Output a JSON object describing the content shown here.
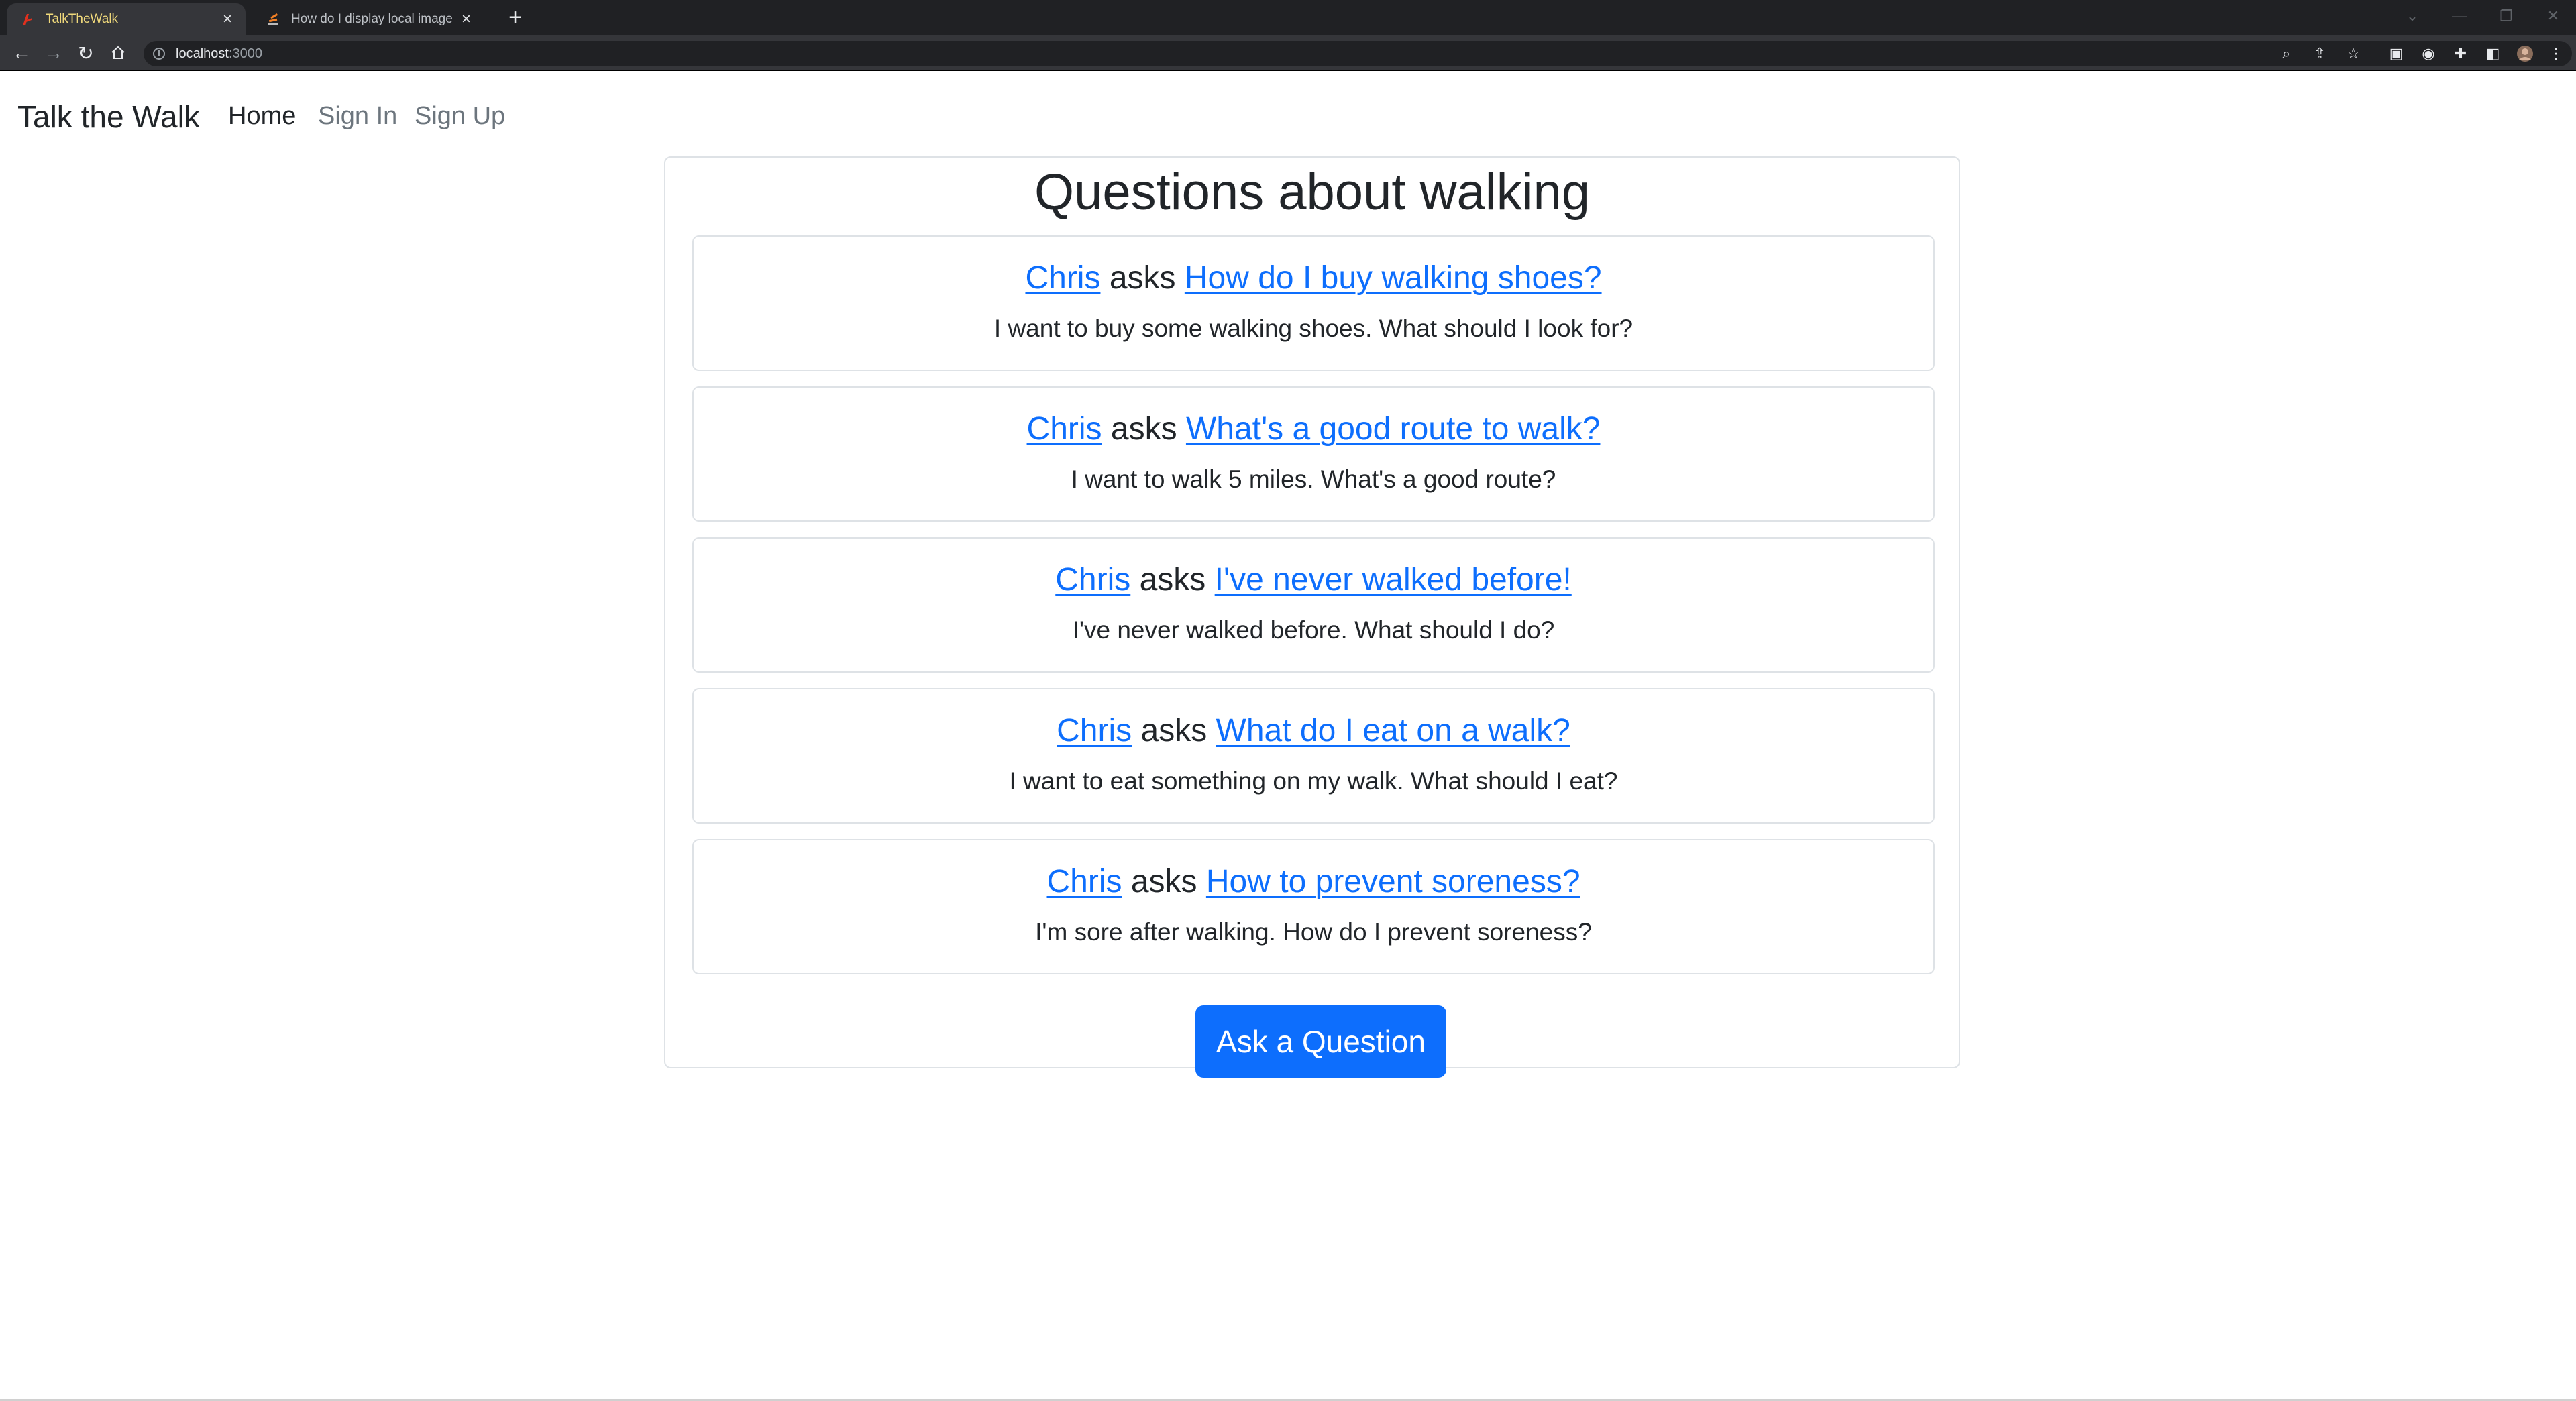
{
  "browser": {
    "tabs": [
      {
        "title": "TalkTheWalk",
        "active": true
      },
      {
        "title": "How do I display local image in ...",
        "active": false
      }
    ],
    "url_host": "localhost",
    "url_port": ":3000"
  },
  "navbar": {
    "brand": "Talk the Walk",
    "links": {
      "home": "Home",
      "signin": "Sign In",
      "signup": "Sign Up"
    }
  },
  "main": {
    "title": "Questions about walking",
    "ask_word": "asks",
    "questions": [
      {
        "author": "Chris",
        "title": "How do I buy walking shoes?",
        "body": "I want to buy some walking shoes. What should I look for?"
      },
      {
        "author": "Chris",
        "title": "What's a good route to walk?",
        "body": "I want to walk 5 miles. What's a good route?"
      },
      {
        "author": "Chris",
        "title": "I've never walked before!",
        "body": "I've never walked before. What should I do?"
      },
      {
        "author": "Chris",
        "title": "What do I eat on a walk?",
        "body": "I want to eat something on my walk. What should I eat?"
      },
      {
        "author": "Chris",
        "title": "How to prevent soreness?",
        "body": "I'm sore after walking. How do I prevent soreness?"
      }
    ],
    "ask_button": "Ask a Question"
  },
  "colors": {
    "link": "#0d6efd",
    "button": "#0d6efd",
    "text": "#212529",
    "muted": "#6c757d"
  }
}
